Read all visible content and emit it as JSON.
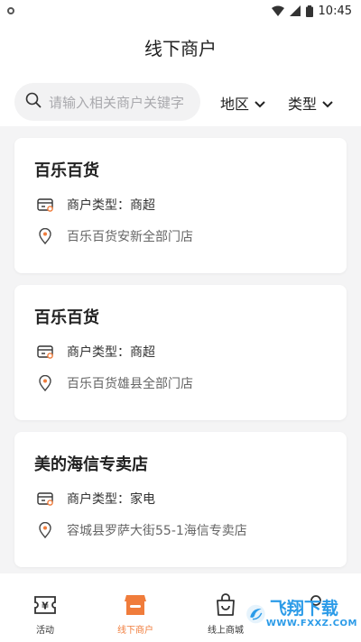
{
  "status_bar": {
    "time": "10:45"
  },
  "page": {
    "title": "线下商户"
  },
  "search": {
    "placeholder": "请输入相关商户关键字"
  },
  "filters": [
    {
      "label": "地区"
    },
    {
      "label": "类型"
    }
  ],
  "merchants": [
    {
      "name": "百乐百货",
      "type_line": "商户类型：商超",
      "address": "百乐百货安新全部门店"
    },
    {
      "name": "百乐百货",
      "type_line": "商户类型：商超",
      "address": "百乐百货雄县全部门店"
    },
    {
      "name": "美的海信专卖店",
      "type_line": "商户类型：家电",
      "address": "容城县罗萨大街55-1海信专卖店"
    }
  ],
  "tabbar": {
    "items": [
      {
        "label": "活动",
        "active": false
      },
      {
        "label": "线下商户",
        "active": true
      },
      {
        "label": "线上商城",
        "active": false
      }
    ]
  },
  "watermark": {
    "text": "飞翔下载",
    "url": "WWW.FXXZ.COM"
  },
  "colors": {
    "accent": "#f07c3b",
    "watermark": "#2b9be8"
  }
}
